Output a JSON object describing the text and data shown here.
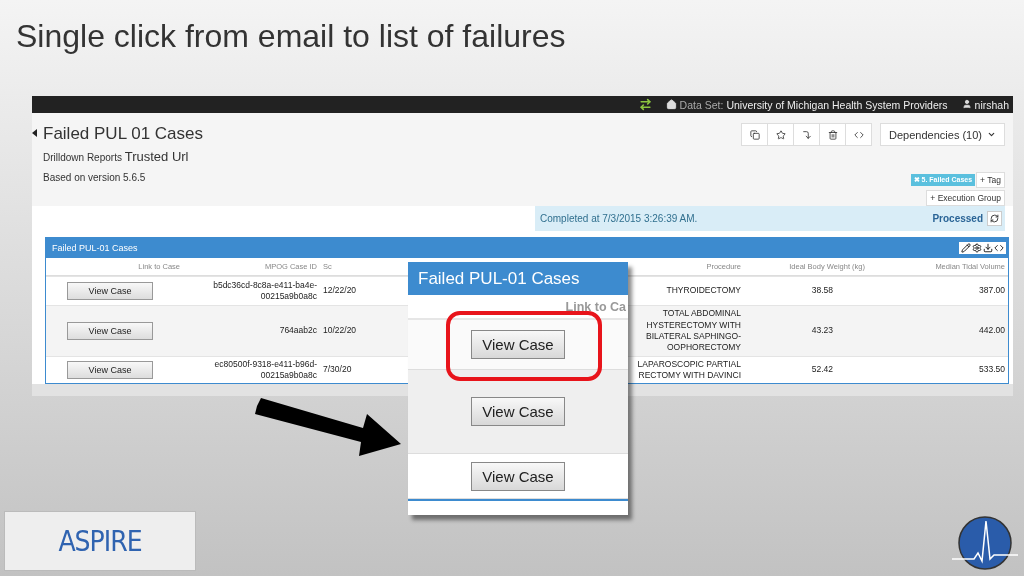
{
  "slide": {
    "title": "Single click from email to list of failures",
    "logo": "ASPIRE"
  },
  "navbar": {
    "data_set_label": "Data Set:",
    "data_set": "University of Michigan Health System Providers",
    "user": "nirshah"
  },
  "report": {
    "title": "Failed PUL 01 Cases",
    "breadcrumb": "Drilldown Reports",
    "breadcrumb_current": "Trusted Url",
    "version": "Based on version 5.6.5",
    "dependencies": "Dependencies (10)",
    "tag": "✖ 5. Failed Cases",
    "tag_button": "+ Tag",
    "group_button": "+ Execution Group",
    "status": "Completed at 7/3/2015 3:26:39 AM.",
    "state": "Processed"
  },
  "table": {
    "title": "Failed PUL-01 Cases",
    "columns": {
      "link_to_case": "Link to Case",
      "case_id": "MPOG Case ID",
      "column_3": "Sc",
      "procedure": "Procedure",
      "weight": "Ideal Body Weight (kg)",
      "volume": "Median Tidal Volume"
    },
    "rows": [
      {
        "button": "View Case",
        "case_id": [
          "b5dc36cd-8c8a-e411-ba4e-",
          "00215a9b0a8c"
        ],
        "column_3": "12/22/20",
        "procedure": [
          "THYROIDECTOMY"
        ],
        "weight": "38.58",
        "volume": "387.00"
      },
      {
        "button": "View Case",
        "case_id": [
          "764aab2c"
        ],
        "column_3": "10/22/20",
        "procedure": [
          "TOTAL ABDOMINAL",
          "HYSTERECTOMY WITH",
          "BILATERAL SAPHINGO-",
          "OOPHORECTOMY"
        ],
        "weight": "43.23",
        "volume": "442.00"
      },
      {
        "button": "View Case",
        "case_id": [
          "ec80500f-9318-e411-b96d-",
          "00215a9b0a8c"
        ],
        "column_3": "7/30/20",
        "procedure": [
          "LAPAROSCOPIC PARTIAL",
          "RECTOMY WITH DAVINCI"
        ],
        "weight": "52.42",
        "volume": "533.50"
      }
    ]
  },
  "callout": {
    "title": "Failed PUL-01 Cases",
    "header": "Link to Ca",
    "rows": [
      {
        "button": "View Case",
        "highlighted": true
      },
      {
        "button": "View Case",
        "highlighted": false
      },
      {
        "button": "View Case",
        "highlighted": false
      }
    ]
  }
}
